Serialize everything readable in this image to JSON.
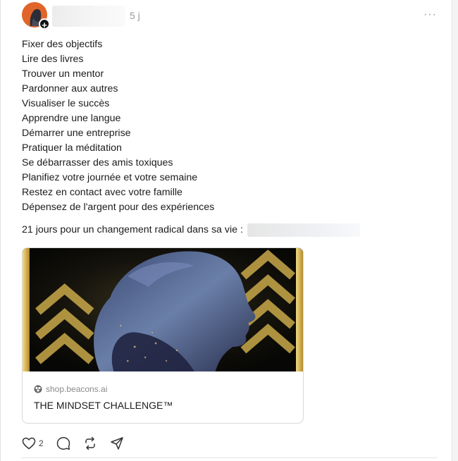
{
  "header": {
    "time": "5 j",
    "more_label": "···",
    "plus_label": "+"
  },
  "post": {
    "lines": [
      "Fixer des objectifs",
      "Lire des livres",
      "Trouver un mentor",
      "Pardonner aux autres",
      "Visualiser le succès",
      "Apprendre une langue",
      "Démarrer une entreprise",
      "Pratiquer la méditation",
      "Se débarrasser des amis toxiques",
      "Planifiez votre journée et votre semaine",
      "Restez en contact avec votre famille",
      "Dépensez de l'argent pour des expériences"
    ],
    "summary": "21 jours pour un changement radical dans sa vie :"
  },
  "link_preview": {
    "domain": "shop.beacons.ai",
    "title": "THE MINDSET CHALLENGE™"
  },
  "actions": {
    "like_count": "2",
    "icons": [
      "heart-icon",
      "comment-icon",
      "repost-icon",
      "share-icon"
    ]
  },
  "colors": {
    "accent_gold": "#c9a94a",
    "avatar_orange": "#e0652a",
    "muted_text": "#999999"
  }
}
